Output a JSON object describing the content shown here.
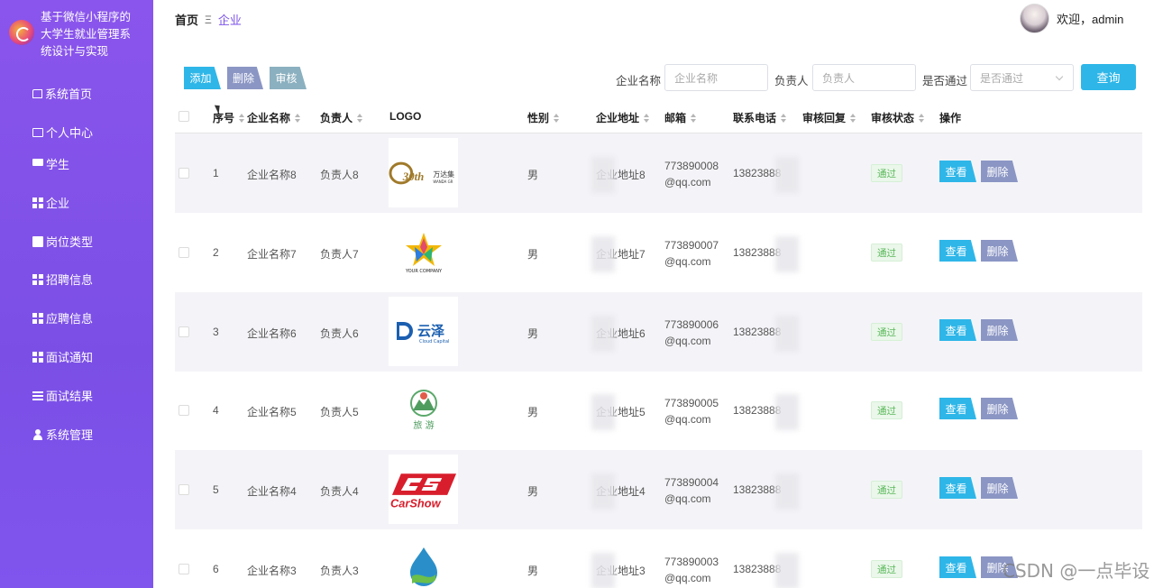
{
  "app": {
    "title": "基于微信小程序的大学生就业管理系统设计与实现"
  },
  "sidebar": {
    "items": [
      {
        "label": "系统首页",
        "icon": "home-icon"
      },
      {
        "label": "个人中心",
        "icon": "id-card-icon"
      },
      {
        "label": "学生",
        "icon": "monitor-icon"
      },
      {
        "label": "企业",
        "icon": "grid-icon"
      },
      {
        "label": "岗位类型",
        "icon": "document-icon"
      },
      {
        "label": "招聘信息",
        "icon": "grid-icon"
      },
      {
        "label": "应聘信息",
        "icon": "grid-icon"
      },
      {
        "label": "面试通知",
        "icon": "grid-icon"
      },
      {
        "label": "面试结果",
        "icon": "list-icon"
      },
      {
        "label": "系统管理",
        "icon": "user-icon"
      }
    ]
  },
  "header": {
    "breadcrumb": {
      "home": "首页",
      "separator": "Ξ",
      "current": "企业"
    },
    "welcome": "欢迎，admin"
  },
  "toolbar": {
    "add_label": "添加",
    "delete_label": "删除",
    "audit_label": "审核"
  },
  "filters": {
    "company_name": {
      "label": "企业名称",
      "placeholder": "企业名称"
    },
    "owner": {
      "label": "负责人",
      "placeholder": "负责人"
    },
    "passed": {
      "label": "是否通过",
      "placeholder": "是否通过"
    },
    "query_label": "查询"
  },
  "table": {
    "columns": [
      "序号",
      "企业名称",
      "负责人",
      "LOGO",
      "性别",
      "企业地址",
      "邮箱",
      "联系电话",
      "审核回复",
      "审核状态",
      "操作"
    ],
    "rows": [
      {
        "index": "1",
        "name": "企业名称8",
        "owner": "负责人8",
        "logo": "30th 万达集团 WANDA GROUP",
        "gender": "男",
        "address": "企业地址8",
        "email": "773890008@qq.com",
        "phone": "13823888",
        "reply": "",
        "status": "通过",
        "view": "查看",
        "delete": "删除"
      },
      {
        "index": "2",
        "name": "企业名称7",
        "owner": "负责人7",
        "logo": "YOUR COMPANY",
        "gender": "男",
        "address": "企业地址7",
        "email": "773890007@qq.com",
        "phone": "13823888",
        "reply": "",
        "status": "通过",
        "view": "查看",
        "delete": "删除"
      },
      {
        "index": "3",
        "name": "企业名称6",
        "owner": "负责人6",
        "logo": "云泽 Cloud Capital",
        "gender": "男",
        "address": "企业地址6",
        "email": "773890006@qq.com",
        "phone": "13823888",
        "reply": "",
        "status": "通过",
        "view": "查看",
        "delete": "删除"
      },
      {
        "index": "4",
        "name": "企业名称5",
        "owner": "负责人5",
        "logo": "旅游",
        "gender": "男",
        "address": "企业地址5",
        "email": "773890005@qq.com",
        "phone": "13823888",
        "reply": "",
        "status": "通过",
        "view": "查看",
        "delete": "删除"
      },
      {
        "index": "5",
        "name": "企业名称4",
        "owner": "负责人4",
        "logo": "CarShow",
        "gender": "男",
        "address": "企业地址4",
        "email": "773890004@qq.com",
        "phone": "13823888",
        "reply": "",
        "status": "通过",
        "view": "查看",
        "delete": "删除"
      },
      {
        "index": "6",
        "name": "企业名称3",
        "owner": "负责人3",
        "logo": "",
        "gender": "男",
        "address": "企业地址3",
        "email": "773890003@qq.com",
        "phone": "13823888",
        "reply": "",
        "status": "通过",
        "view": "查看",
        "delete": "删除"
      }
    ]
  },
  "watermark": "CSDN @一点毕设",
  "colors": {
    "sidebar": "#8a55ec",
    "accent": "#7b52e8",
    "primary_button": "#2eb6e8",
    "danger_button": "#8b96c4",
    "audit_button": "#8bb0bf",
    "status_pass": "#5cb85c"
  }
}
